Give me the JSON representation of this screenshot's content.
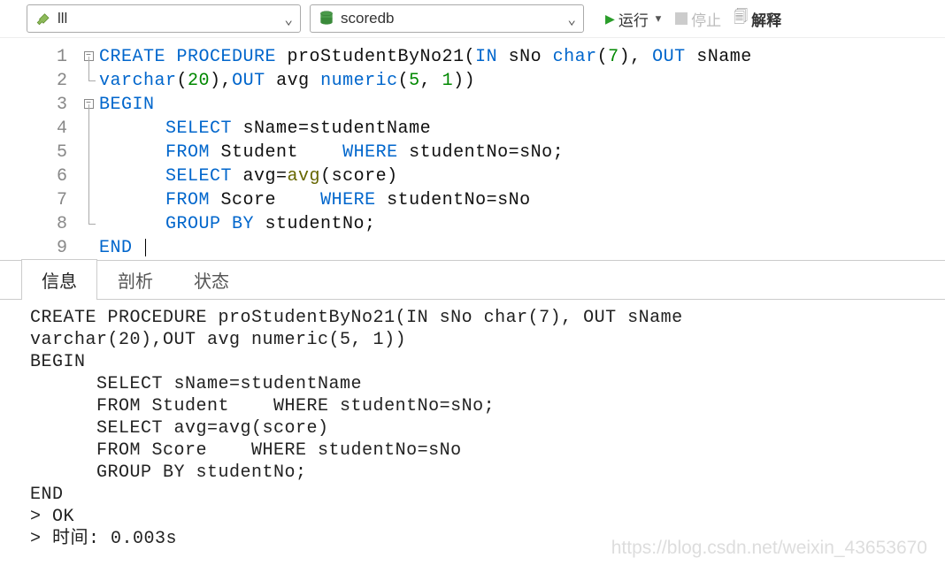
{
  "toolbar": {
    "connection": {
      "label": "lll"
    },
    "database": {
      "label": "scoredb"
    },
    "run": {
      "label": "运行"
    },
    "stop": {
      "label": "停止"
    },
    "explain": {
      "label": "解释"
    }
  },
  "editor": {
    "lineNumbers": [
      "1",
      "2",
      "3",
      "4",
      "5",
      "6",
      "7",
      "8",
      "9"
    ],
    "lines": [
      [
        [
          "kw",
          "CREATE PROCEDURE"
        ],
        [
          "",
          " proStudentByNo21("
        ],
        [
          "kw",
          "IN"
        ],
        [
          "",
          " sNo "
        ],
        [
          "type",
          "char"
        ],
        [
          "",
          "("
        ],
        [
          "num",
          "7"
        ],
        [
          "",
          "), "
        ],
        [
          "kw",
          "OUT"
        ],
        [
          "",
          " sName"
        ]
      ],
      [
        [
          "type",
          "varchar"
        ],
        [
          "",
          "("
        ],
        [
          "num",
          "20"
        ],
        [
          "",
          "),"
        ],
        [
          "kw",
          "OUT"
        ],
        [
          "",
          " avg "
        ],
        [
          "type",
          "numeric"
        ],
        [
          "",
          "("
        ],
        [
          "num",
          "5"
        ],
        [
          "",
          ", "
        ],
        [
          "num",
          "1"
        ],
        [
          "",
          "))"
        ]
      ],
      [
        [
          "kw",
          "BEGIN"
        ]
      ],
      [
        [
          "",
          "      "
        ],
        [
          "kw",
          "SELECT"
        ],
        [
          "",
          " sName=studentName"
        ]
      ],
      [
        [
          "",
          "      "
        ],
        [
          "kw",
          "FROM"
        ],
        [
          "",
          " Student    "
        ],
        [
          "kw",
          "WHERE"
        ],
        [
          "",
          " studentNo=sNo;"
        ]
      ],
      [
        [
          "",
          "      "
        ],
        [
          "kw",
          "SELECT"
        ],
        [
          "",
          " avg="
        ],
        [
          "func",
          "avg"
        ],
        [
          "",
          "(score)"
        ]
      ],
      [
        [
          "",
          "      "
        ],
        [
          "kw",
          "FROM"
        ],
        [
          "",
          " Score    "
        ],
        [
          "kw",
          "WHERE"
        ],
        [
          "",
          " studentNo=sNo"
        ]
      ],
      [
        [
          "",
          "      "
        ],
        [
          "kw",
          "GROUP BY"
        ],
        [
          "",
          " studentNo;"
        ]
      ],
      [
        [
          "kw",
          "END"
        ],
        [
          "",
          " "
        ]
      ]
    ]
  },
  "tabs": {
    "info": "信息",
    "profile": "剖析",
    "status": "状态",
    "active": 0
  },
  "output": "CREATE PROCEDURE proStudentByNo21(IN sNo char(7), OUT sName\nvarchar(20),OUT avg numeric(5, 1))\nBEGIN\n      SELECT sName=studentName\n      FROM Student    WHERE studentNo=sNo;\n      SELECT avg=avg(score)\n      FROM Score    WHERE studentNo=sNo\n      GROUP BY studentNo;\nEND\n> OK\n> 时间: 0.003s",
  "watermark": "https://blog.csdn.net/weixin_43653670"
}
